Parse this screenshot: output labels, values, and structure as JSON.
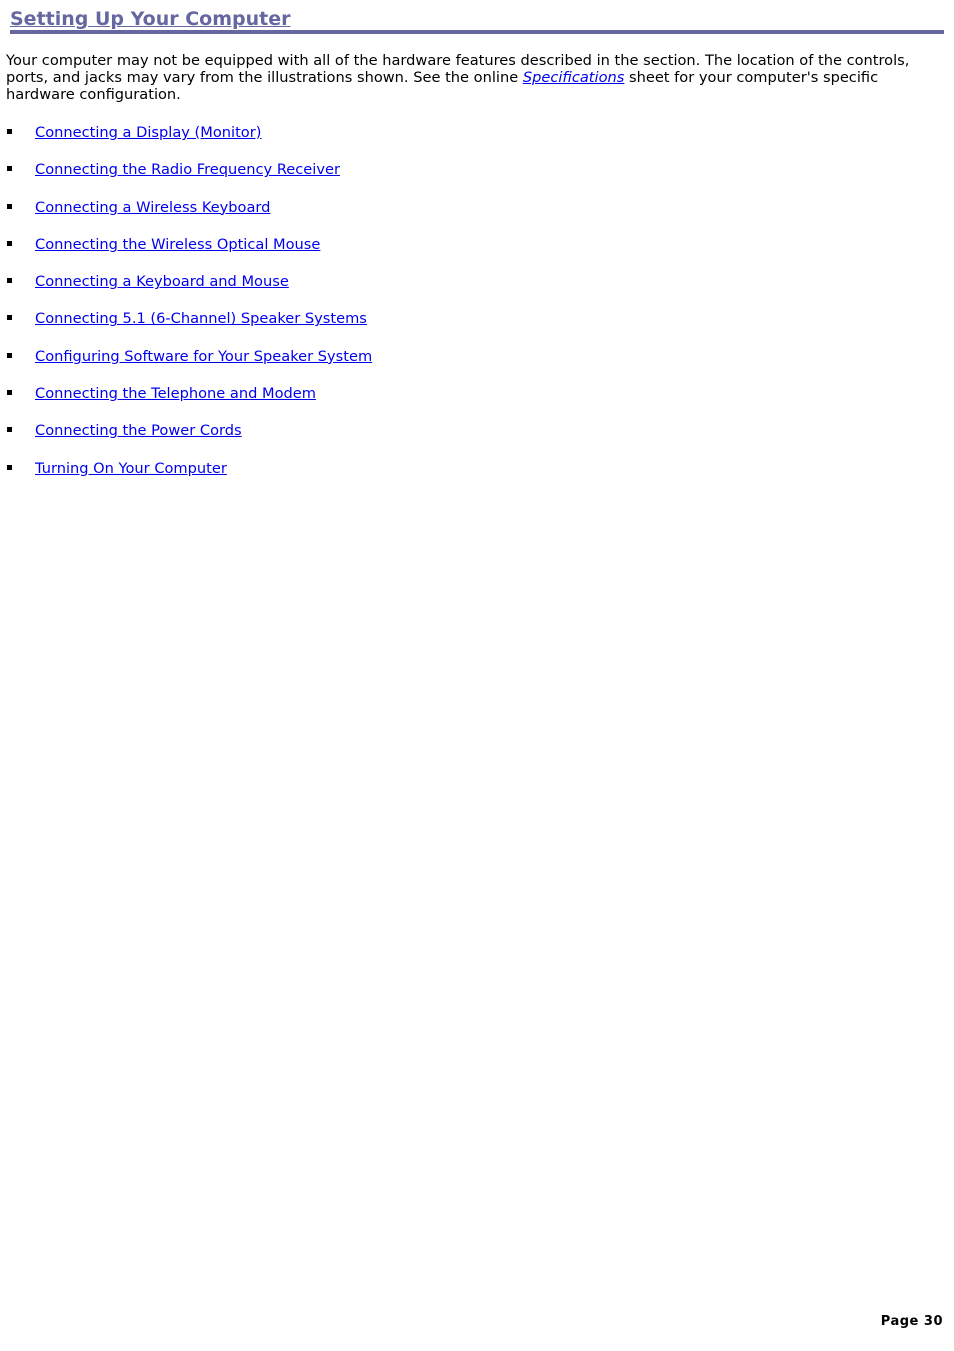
{
  "header": {
    "title": "Setting Up Your Computer"
  },
  "intro": {
    "text_before": "Your computer may not be equipped with all of the hardware features described in the section. The location of the controls, ports, and jacks may vary from the illustrations shown. See the online ",
    "link": "Specifications",
    "text_after": " sheet for your computer's specific hardware configuration."
  },
  "links": [
    {
      "label": "Connecting a Display (Monitor)"
    },
    {
      "label": "Connecting the Radio Frequency Receiver"
    },
    {
      "label": "Connecting a Wireless Keyboard"
    },
    {
      "label": "Connecting the Wireless Optical Mouse"
    },
    {
      "label": "Connecting a Keyboard and Mouse"
    },
    {
      "label": "Connecting 5.1 (6-Channel) Speaker Systems"
    },
    {
      "label": "Configuring Software for Your Speaker System"
    },
    {
      "label": "Connecting the Telephone and Modem"
    },
    {
      "label": "Connecting the Power Cords"
    },
    {
      "label": "Turning On Your Computer"
    }
  ],
  "footer": {
    "page": "Page 30"
  },
  "colors": {
    "title": "#6667a0",
    "link": "#0000ee"
  }
}
